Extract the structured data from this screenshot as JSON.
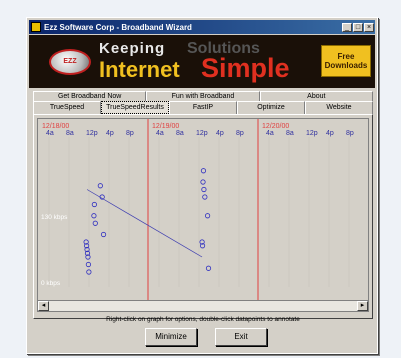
{
  "window": {
    "title": "Ezz Software Corp - Broadband Wizard",
    "controls": [
      "_",
      "□",
      "×"
    ]
  },
  "banner": {
    "logo_text": "EZZ",
    "line1": "Keeping",
    "line1b": "Solutions",
    "line2": "Internet",
    "line2b": "Simple",
    "free_button": "Free Downloads"
  },
  "tabs_row1": [
    "Get Broadband Now",
    "Fun with Broadband",
    "About"
  ],
  "tabs_row2": [
    "TrueSpeed",
    "TrueSpeedResults",
    "FastIP",
    "Optimize",
    "Website"
  ],
  "active_tab": "TrueSpeedResults",
  "graph": {
    "dates": [
      "12/18/00",
      "12/19/00",
      "12/20/00"
    ],
    "hour_labels": [
      "4a",
      "8a",
      "12p",
      "4p",
      "8p"
    ],
    "y_labels": [
      "130 kbps",
      "0 kbps"
    ]
  },
  "chart_data": {
    "type": "scatter",
    "xlabel": "",
    "ylabel": "",
    "x_tick_labels": [
      "4a",
      "8a",
      "12p",
      "4p",
      "8p",
      "4a",
      "8a",
      "12p",
      "4p",
      "8p",
      "4a",
      "8a",
      "12p",
      "4p",
      "8p"
    ],
    "day_labels": [
      "12/18/00",
      "12/19/00",
      "12/20/00"
    ],
    "y_tick_labels": [
      "130 kbps",
      "0 kbps"
    ],
    "ylim": [
      0,
      200
    ],
    "xlim": [
      0,
      72
    ],
    "series": [
      {
        "x": [
          10.5,
          10.6,
          10.7,
          10.8,
          10.9,
          11.0,
          11.1,
          12.2,
          12.3,
          12.5,
          13.6,
          14.0,
          14.3,
          35.8,
          35.9,
          36.0,
          36.1,
          36.2,
          36.4,
          37.0,
          37.2
        ],
        "y": [
          60,
          55,
          50,
          45,
          40,
          30,
          20,
          95,
          110,
          85,
          135,
          120,
          70,
          60,
          55,
          140,
          155,
          130,
          120,
          95,
          25
        ]
      }
    ],
    "connector_line": {
      "x": [
        10.7,
        35.8
      ],
      "y": [
        130,
        40
      ]
    },
    "grid": false
  },
  "hint": "Right-click on graph for options, double-click datapoints to annotate",
  "buttons": {
    "minimize": "Minimize",
    "exit": "Exit"
  }
}
